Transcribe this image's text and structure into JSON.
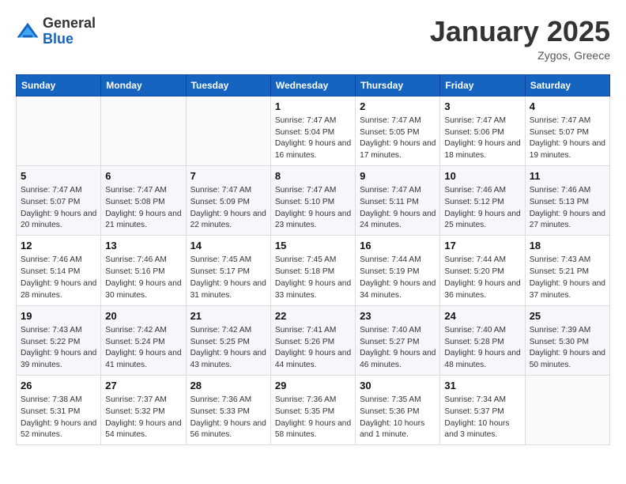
{
  "logo": {
    "general": "General",
    "blue": "Blue"
  },
  "header": {
    "month": "January 2025",
    "location": "Zygos, Greece"
  },
  "weekdays": [
    "Sunday",
    "Monday",
    "Tuesday",
    "Wednesday",
    "Thursday",
    "Friday",
    "Saturday"
  ],
  "weeks": [
    [
      {
        "date": "",
        "info": ""
      },
      {
        "date": "",
        "info": ""
      },
      {
        "date": "",
        "info": ""
      },
      {
        "date": "1",
        "info": "Sunrise: 7:47 AM\nSunset: 5:04 PM\nDaylight: 9 hours and 16 minutes."
      },
      {
        "date": "2",
        "info": "Sunrise: 7:47 AM\nSunset: 5:05 PM\nDaylight: 9 hours and 17 minutes."
      },
      {
        "date": "3",
        "info": "Sunrise: 7:47 AM\nSunset: 5:06 PM\nDaylight: 9 hours and 18 minutes."
      },
      {
        "date": "4",
        "info": "Sunrise: 7:47 AM\nSunset: 5:07 PM\nDaylight: 9 hours and 19 minutes."
      }
    ],
    [
      {
        "date": "5",
        "info": "Sunrise: 7:47 AM\nSunset: 5:07 PM\nDaylight: 9 hours and 20 minutes."
      },
      {
        "date": "6",
        "info": "Sunrise: 7:47 AM\nSunset: 5:08 PM\nDaylight: 9 hours and 21 minutes."
      },
      {
        "date": "7",
        "info": "Sunrise: 7:47 AM\nSunset: 5:09 PM\nDaylight: 9 hours and 22 minutes."
      },
      {
        "date": "8",
        "info": "Sunrise: 7:47 AM\nSunset: 5:10 PM\nDaylight: 9 hours and 23 minutes."
      },
      {
        "date": "9",
        "info": "Sunrise: 7:47 AM\nSunset: 5:11 PM\nDaylight: 9 hours and 24 minutes."
      },
      {
        "date": "10",
        "info": "Sunrise: 7:46 AM\nSunset: 5:12 PM\nDaylight: 9 hours and 25 minutes."
      },
      {
        "date": "11",
        "info": "Sunrise: 7:46 AM\nSunset: 5:13 PM\nDaylight: 9 hours and 27 minutes."
      }
    ],
    [
      {
        "date": "12",
        "info": "Sunrise: 7:46 AM\nSunset: 5:14 PM\nDaylight: 9 hours and 28 minutes."
      },
      {
        "date": "13",
        "info": "Sunrise: 7:46 AM\nSunset: 5:16 PM\nDaylight: 9 hours and 30 minutes."
      },
      {
        "date": "14",
        "info": "Sunrise: 7:45 AM\nSunset: 5:17 PM\nDaylight: 9 hours and 31 minutes."
      },
      {
        "date": "15",
        "info": "Sunrise: 7:45 AM\nSunset: 5:18 PM\nDaylight: 9 hours and 33 minutes."
      },
      {
        "date": "16",
        "info": "Sunrise: 7:44 AM\nSunset: 5:19 PM\nDaylight: 9 hours and 34 minutes."
      },
      {
        "date": "17",
        "info": "Sunrise: 7:44 AM\nSunset: 5:20 PM\nDaylight: 9 hours and 36 minutes."
      },
      {
        "date": "18",
        "info": "Sunrise: 7:43 AM\nSunset: 5:21 PM\nDaylight: 9 hours and 37 minutes."
      }
    ],
    [
      {
        "date": "19",
        "info": "Sunrise: 7:43 AM\nSunset: 5:22 PM\nDaylight: 9 hours and 39 minutes."
      },
      {
        "date": "20",
        "info": "Sunrise: 7:42 AM\nSunset: 5:24 PM\nDaylight: 9 hours and 41 minutes."
      },
      {
        "date": "21",
        "info": "Sunrise: 7:42 AM\nSunset: 5:25 PM\nDaylight: 9 hours and 43 minutes."
      },
      {
        "date": "22",
        "info": "Sunrise: 7:41 AM\nSunset: 5:26 PM\nDaylight: 9 hours and 44 minutes."
      },
      {
        "date": "23",
        "info": "Sunrise: 7:40 AM\nSunset: 5:27 PM\nDaylight: 9 hours and 46 minutes."
      },
      {
        "date": "24",
        "info": "Sunrise: 7:40 AM\nSunset: 5:28 PM\nDaylight: 9 hours and 48 minutes."
      },
      {
        "date": "25",
        "info": "Sunrise: 7:39 AM\nSunset: 5:30 PM\nDaylight: 9 hours and 50 minutes."
      }
    ],
    [
      {
        "date": "26",
        "info": "Sunrise: 7:38 AM\nSunset: 5:31 PM\nDaylight: 9 hours and 52 minutes."
      },
      {
        "date": "27",
        "info": "Sunrise: 7:37 AM\nSunset: 5:32 PM\nDaylight: 9 hours and 54 minutes."
      },
      {
        "date": "28",
        "info": "Sunrise: 7:36 AM\nSunset: 5:33 PM\nDaylight: 9 hours and 56 minutes."
      },
      {
        "date": "29",
        "info": "Sunrise: 7:36 AM\nSunset: 5:35 PM\nDaylight: 9 hours and 58 minutes."
      },
      {
        "date": "30",
        "info": "Sunrise: 7:35 AM\nSunset: 5:36 PM\nDaylight: 10 hours and 1 minute."
      },
      {
        "date": "31",
        "info": "Sunrise: 7:34 AM\nSunset: 5:37 PM\nDaylight: 10 hours and 3 minutes."
      },
      {
        "date": "",
        "info": ""
      }
    ]
  ]
}
